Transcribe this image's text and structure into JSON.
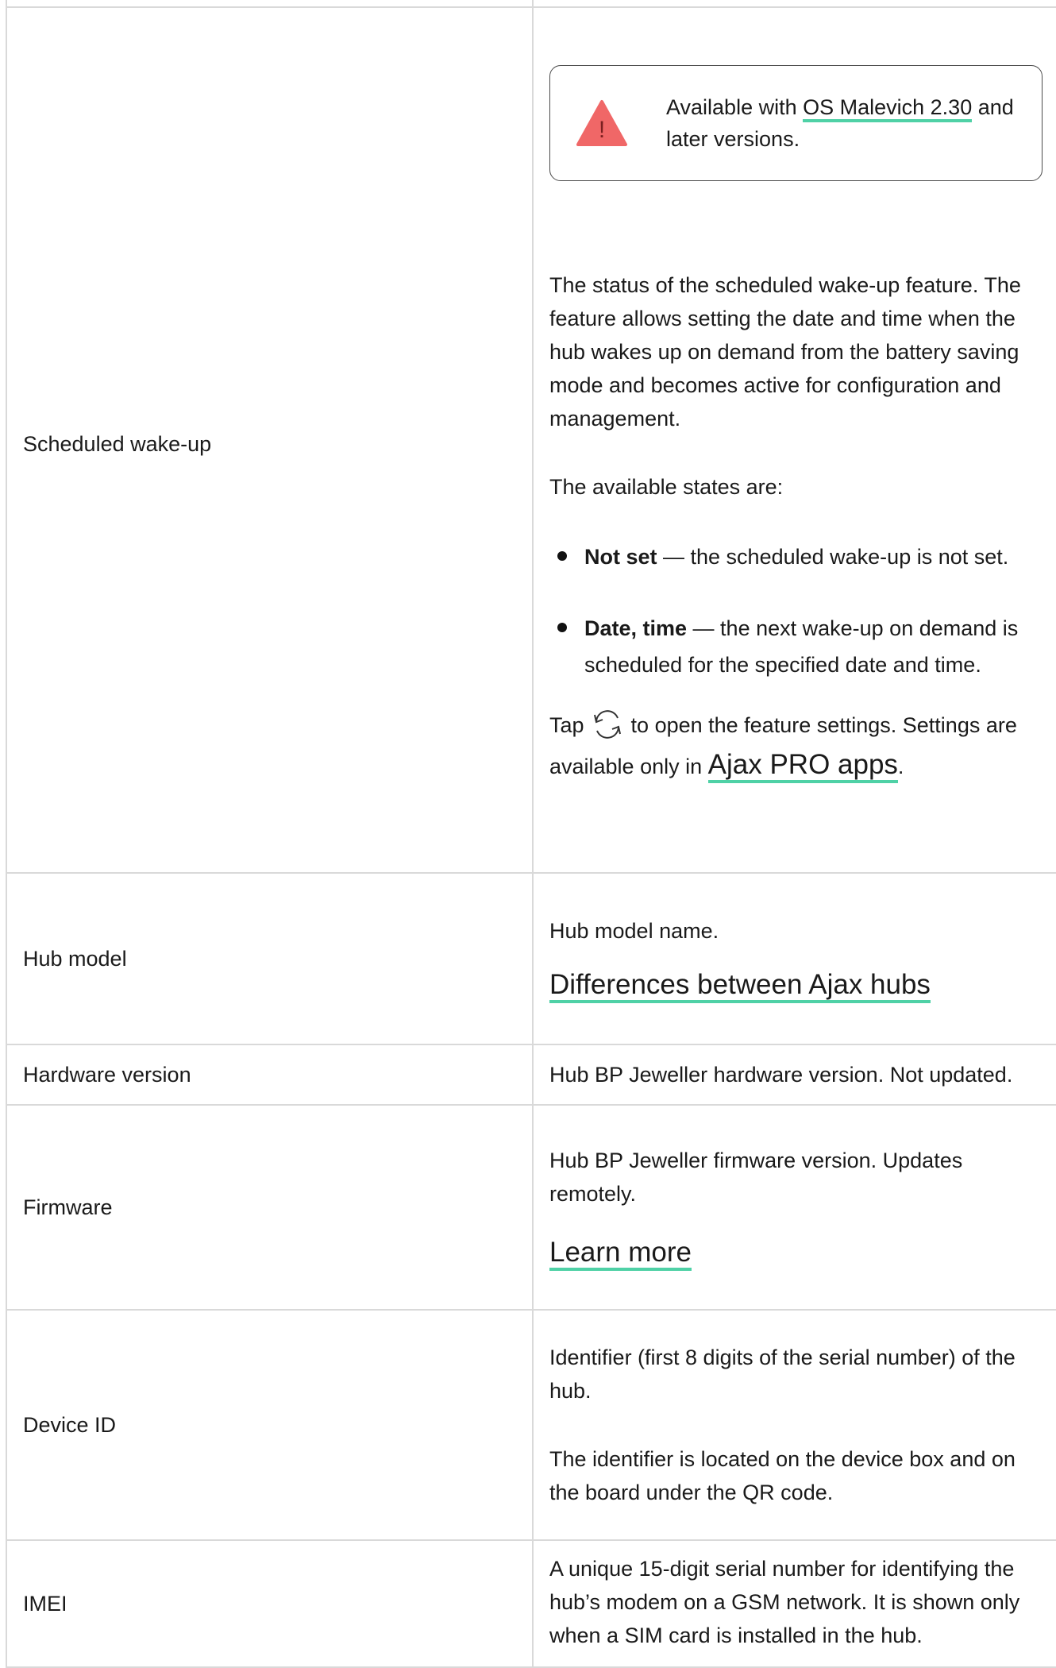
{
  "rows": {
    "scheduled_wakeup": {
      "label": "Scheduled wake-up",
      "notice": {
        "prefix": "Available with ",
        "link": "OS Malevich 2.30",
        "suffix": " and later versions.",
        "icon": "warning-triangle-icon",
        "icon_color": "#f06767"
      },
      "intro": "The status of the scheduled wake-up feature. The feature allows setting the date and time when the hub wakes up on demand from the battery saving mode and becomes active for configuration and management.",
      "states_heading": "The available states are:",
      "states": [
        {
          "name": "Not set",
          "desc": " — the scheduled wake-up is not set."
        },
        {
          "name": "Date, time",
          "desc": " — the next wake-up on demand is scheduled for the specified date and time."
        }
      ],
      "tap_prefix": "Tap ",
      "tap_icon": "refresh-icon",
      "tap_suffix": " to open the feature settings. Settings are available only in ",
      "tap_link": "Ajax PRO apps",
      "tap_end": "."
    },
    "hub_model": {
      "label": "Hub model",
      "desc": "Hub model name.",
      "link": "Differences between Ajax hubs"
    },
    "hardware_version": {
      "label": "Hardware version",
      "desc": "Hub BP Jeweller hardware version. Not updated."
    },
    "firmware": {
      "label": "Firmware",
      "desc": "Hub BP Jeweller firmware version. Updates remotely.",
      "link": "Learn more"
    },
    "device_id": {
      "label": "Device ID",
      "desc1": "Identifier (first 8 digits of the serial number) of the hub.",
      "desc2": "The identifier is located on the device box and on the board under the QR code."
    },
    "imei": {
      "label": "IMEI",
      "desc": "A unique 15-digit serial number for identifying the hub’s modem on a GSM network. It is shown only when a SIM card is installed in the hub."
    }
  },
  "colors": {
    "link_underline": "#4fd1a6",
    "border": "#d9d9d9"
  }
}
